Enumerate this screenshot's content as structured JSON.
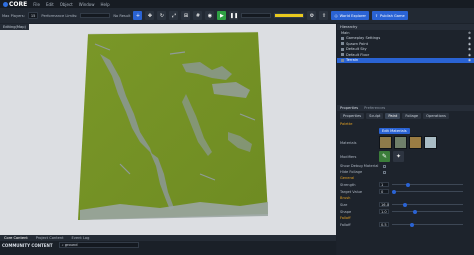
{
  "menubar": {
    "logo": "CORE",
    "items": [
      "File",
      "Edit",
      "Object",
      "Window",
      "Help"
    ]
  },
  "toolbar": {
    "max_players_label": "Max Players:",
    "max_players_value": "15",
    "perf_label": "Performance Limits:",
    "no_result_label": "No Result",
    "world_explorer": "World Explorer",
    "publish_game": "Publish Game"
  },
  "viewport": {
    "tab_label": "Editing(Map)",
    "colors": {
      "ground": "#7c9a2a",
      "mountain": "#8e9a97",
      "background": "#dcdee2"
    }
  },
  "bottom": {
    "tabs": [
      "Core Content",
      "Project Content",
      "Event Log"
    ],
    "community_label": "COMMUNITY CONTENT",
    "search_value": "ground"
  },
  "hierarchy": {
    "title": "Hierarchy",
    "root": "Main",
    "items": [
      {
        "label": "Gameplay Settings",
        "selected": false
      },
      {
        "label": "Spawn Point",
        "selected": false
      },
      {
        "label": "Default Sky",
        "selected": false
      },
      {
        "label": "Default Floor",
        "selected": false
      },
      {
        "label": "Terrain",
        "selected": true
      }
    ]
  },
  "properties": {
    "title": "Properties",
    "tab2": "Preferences",
    "tabs": [
      "Properties",
      "Sculpt",
      "Paint",
      "Foliage",
      "Operations"
    ],
    "active_tab": "Paint",
    "palette_section": "Palette",
    "add_materials": "Edit Materials",
    "materials_label": "Materials",
    "modifiers_label": "Modifiers",
    "show_debug": "Show Debug Material",
    "hide_foliage": "Hide Foliage",
    "general_section": "General",
    "strength_label": "Strength",
    "strength_value": "1",
    "target_value_label": "Target Value",
    "target_value": "0",
    "brush_section": "Brush",
    "size_label": "Size",
    "size_value": "16.0",
    "shape_label": "Shape",
    "shape_value": "1.0",
    "falloff_section": "Falloff",
    "falloff_label": "Falloff",
    "falloff_value": "0.5",
    "material_colors": [
      "#8e7a4a",
      "#6f7f6a",
      "#9a7c43",
      "#a9bcc5"
    ]
  }
}
